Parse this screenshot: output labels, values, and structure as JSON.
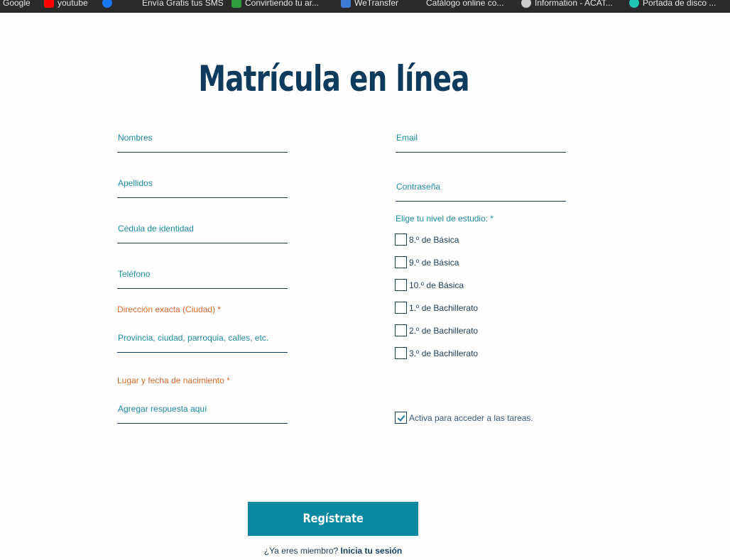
{
  "bookmarks": [
    {
      "label": "Google",
      "icon": "google-icon",
      "color": "#4285f4"
    },
    {
      "label": "youtube",
      "icon": "youtube-icon",
      "color": "#ff0000"
    },
    {
      "label": "",
      "icon": "facebook-icon",
      "color": "#1877f2"
    },
    {
      "label": "Envía Gratis tus SMS",
      "icon": "sms-icon",
      "color": "#2a2a2a"
    },
    {
      "label": "Convirtiendo tu ar...",
      "icon": "converter-icon",
      "color": "#2e9e3e"
    },
    {
      "label": "WeTransfer",
      "icon": "wetransfer-icon",
      "color": "#3d7cd6"
    },
    {
      "label": "Catálogo online co...",
      "icon": "catalog-icon",
      "color": "#2a2a2a"
    },
    {
      "label": "Information - ACAT...",
      "icon": "info-icon",
      "color": "#cccccc"
    },
    {
      "label": "Portada de disco ...",
      "icon": "disc-icon",
      "color": "#20c4b5"
    }
  ],
  "page": {
    "title": "Matrícula en línea"
  },
  "form": {
    "nombres": "Nombres",
    "apellidos": "Apellidos",
    "cedula": "Cédula de identidad",
    "telefono": "Teléfono",
    "direccion_label": "Dirección exacta (Ciudad) *",
    "direccion_placeholder": "Provincia, ciudad, parroquia, calles, etc.",
    "lugar_label": "Lugar y fecha de nacimiento *",
    "lugar_placeholder": "Agregar respuesta aquí",
    "email": "Email",
    "contrasena": "Contraseña",
    "nivel_label": "Elige tu nivel de estudio: *",
    "niveles": [
      {
        "label": "8.º de Básica",
        "checked": false
      },
      {
        "label": "9.º de Básica",
        "checked": false
      },
      {
        "label": "10.º de Básica",
        "checked": false
      },
      {
        "label": "1.º de Bachillerato",
        "checked": false
      },
      {
        "label": "2.º de Bachillerato",
        "checked": false
      },
      {
        "label": "3.º de Bachillerato",
        "checked": false
      }
    ],
    "activa_label": "Activa para acceder a las tareas.",
    "activa_checked": true,
    "submit_label": "Regístrate",
    "member_text": "¿Ya eres miembro? ",
    "login_link": "Inicia tu sesión"
  },
  "colors": {
    "title": "#0e3a5c",
    "field_text": "#1e8aa0",
    "required_label": "#d9692a",
    "button": "#0a89a0",
    "underline": "#163d5e"
  }
}
